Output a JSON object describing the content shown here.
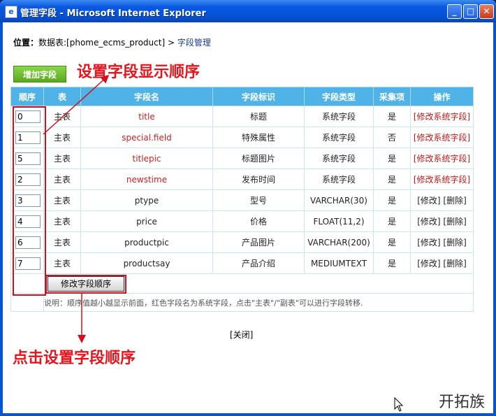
{
  "window": {
    "title": "管理字段 - Microsoft Internet Explorer",
    "minimize": "_",
    "maximize": "□",
    "close": "✕"
  },
  "breadcrumb": {
    "label": "位置：",
    "path": "数据表:[phome_ecms_product] > ",
    "link": "字段管理"
  },
  "add_button": "增加字段",
  "annotations": {
    "top": "设置字段显示顺序",
    "bottom": "点击设置字段顺序"
  },
  "table": {
    "headers": [
      "顺序",
      "表",
      "字段名",
      "字段标识",
      "字段类型",
      "采集项",
      "操作"
    ],
    "rows": [
      {
        "order": "0",
        "table": "主表",
        "name": "title",
        "label": "标题",
        "type": "系统字段",
        "collect": "是",
        "ops": "[修改系统字段]",
        "system": true
      },
      {
        "order": "1",
        "table": "主表",
        "name": "special.field",
        "label": "特殊属性",
        "type": "系统字段",
        "collect": "否",
        "ops": "[修改系统字段]",
        "system": true
      },
      {
        "order": "5",
        "table": "主表",
        "name": "titlepic",
        "label": "标题图片",
        "type": "系统字段",
        "collect": "是",
        "ops": "[修改系统字段]",
        "system": true
      },
      {
        "order": "2",
        "table": "主表",
        "name": "newstime",
        "label": "发布时间",
        "type": "系统字段",
        "collect": "是",
        "ops": "[修改系统字段]",
        "system": true
      },
      {
        "order": "3",
        "table": "主表",
        "name": "ptype",
        "label": "型号",
        "type": "VARCHAR(30)",
        "collect": "是",
        "ops": "[修改] [删除]",
        "system": false
      },
      {
        "order": "4",
        "table": "主表",
        "name": "price",
        "label": "价格",
        "type": "FLOAT(11,2)",
        "collect": "是",
        "ops": "[修改] [删除]",
        "system": false
      },
      {
        "order": "6",
        "table": "主表",
        "name": "productpic",
        "label": "产品图片",
        "type": "VARCHAR(200)",
        "collect": "是",
        "ops": "[修改] [删除]",
        "system": false
      },
      {
        "order": "7",
        "table": "主表",
        "name": "productsay",
        "label": "产品介绍",
        "type": "MEDIUMTEXT",
        "collect": "是",
        "ops": "[修改] [删除]",
        "system": false
      }
    ]
  },
  "submit_button": "修改字段顺序",
  "note": "说明：顺序值越小越显示前面，红色字段名为系统字段，点击\"主表\"/\"副表\"可以进行字段转移.",
  "close_link": "[关闭]",
  "logo_text": "开拓族",
  "colors": {
    "header_bg": "#4fb3e8",
    "system_field": "#d21e1e",
    "annotation": "#e8141c",
    "titlebar": "#0553d6"
  }
}
